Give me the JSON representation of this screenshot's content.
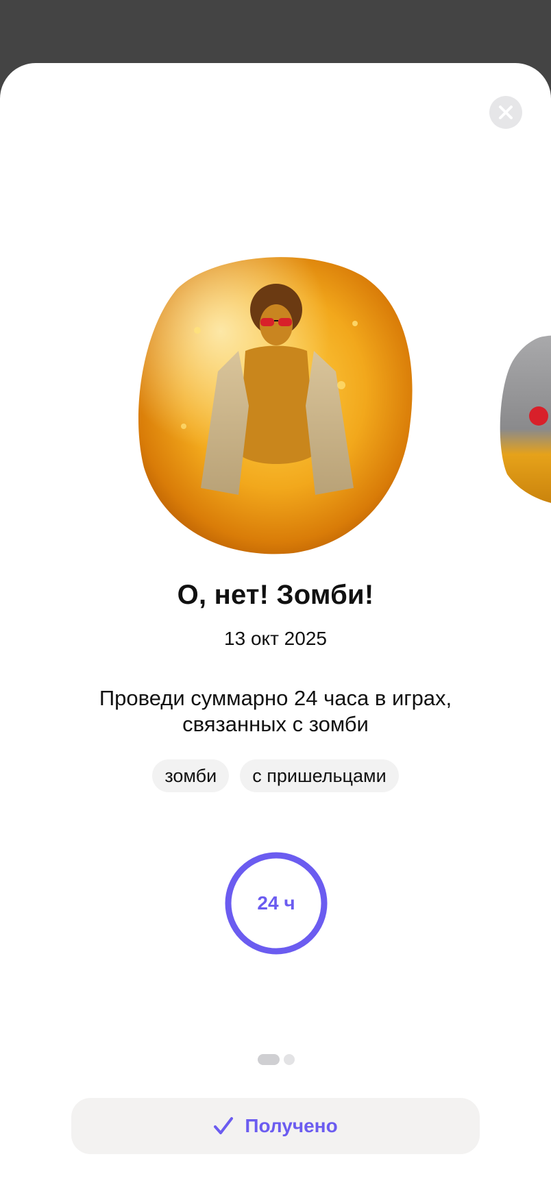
{
  "achievement": {
    "title": "О, нет! Зомби!",
    "date": "13 окт 2025",
    "description": "Проведи суммарно 24 часа в играх, связанных с зомби",
    "tags": [
      "зомби",
      "с пришельцами"
    ],
    "progress": {
      "label": "24 ч",
      "fraction": 1.0
    }
  },
  "pager": {
    "current": 1,
    "total": 2
  },
  "actions": {
    "received_label": "Получено"
  },
  "colors": {
    "accent": "#6b5cf0",
    "amber": "#e8a21a",
    "backdrop": "#444444"
  },
  "icons": {
    "close": "close-icon",
    "check": "check-icon"
  }
}
